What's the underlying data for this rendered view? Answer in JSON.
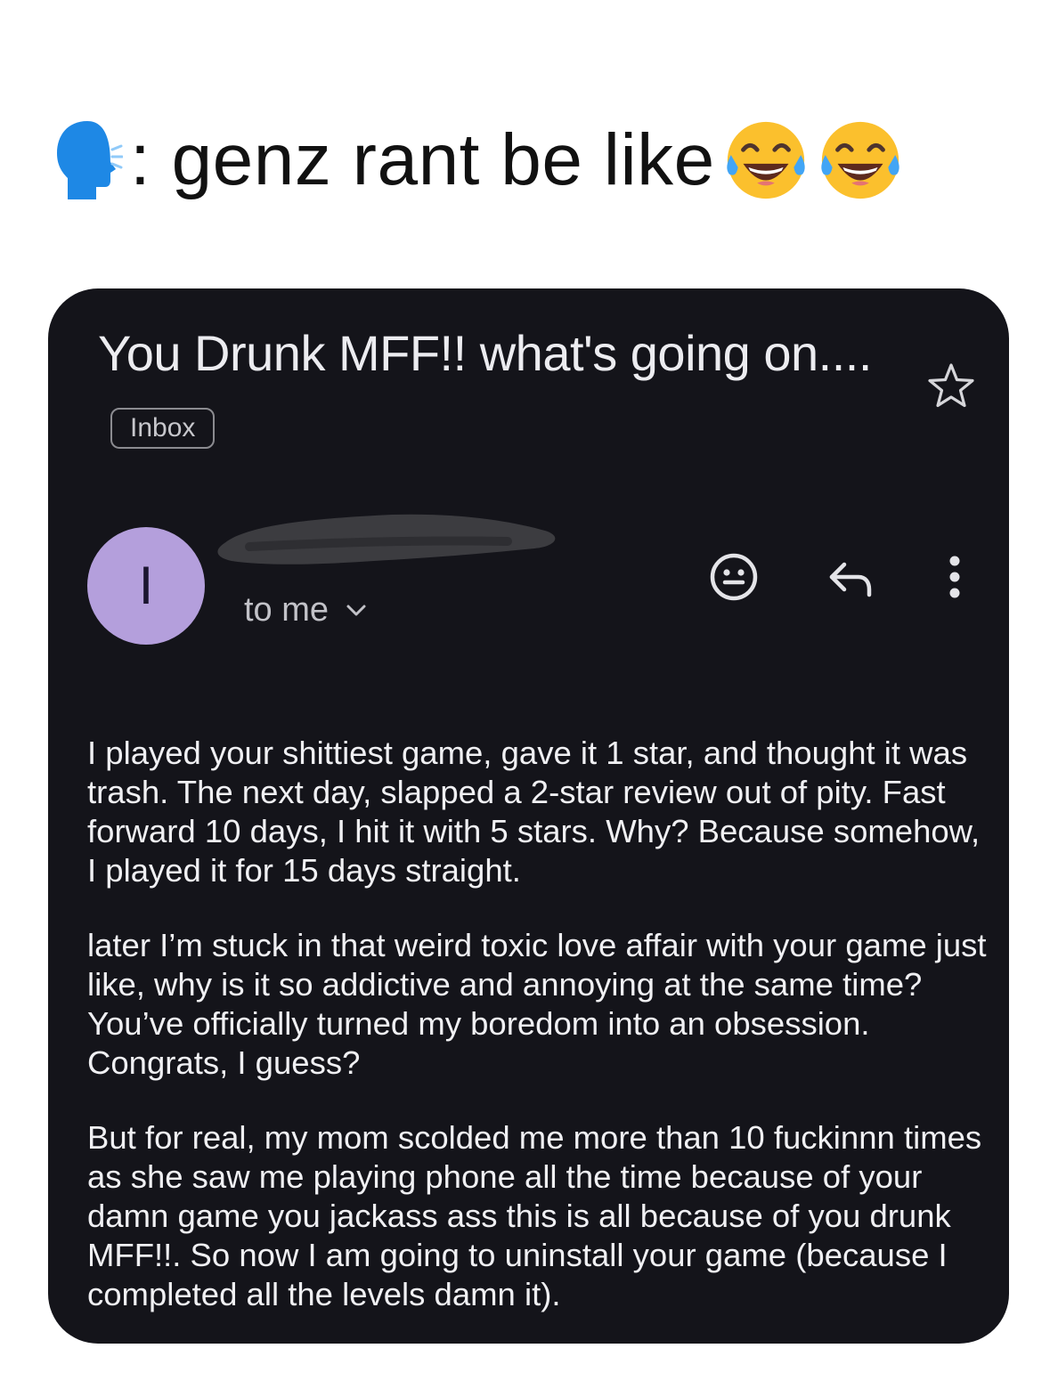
{
  "caption": {
    "text": ": genz rant be like",
    "icons": [
      "speaking-head-icon",
      "laughing-tears-icon",
      "laughing-tears-icon"
    ]
  },
  "email": {
    "subject": "You Drunk MFF!! what's going on....",
    "label": "Inbox",
    "sender_initial": "I",
    "sender_name_redacted": true,
    "recipient": "to me",
    "icons": [
      "star-icon",
      "emoji-reaction-icon",
      "reply-icon",
      "more-vert-icon",
      "chevron-down-icon"
    ],
    "paragraphs": [
      "I played your shittiest game, gave it 1 star, and thought it was trash. The next day, slapped a 2-star review out of pity. Fast forward 10 days, I hit it with 5 stars. Why? Because somehow, I played it for 15 days straight.",
      "later I’m stuck in that weird toxic love affair with your game just like, why is it so addictive and annoying at the same time? You’ve officially turned my boredom into an obsession. Congrats, I guess?",
      "But for real, my mom scolded me more than 10 fuckinnn times as she saw me playing phone all the time because of your damn game you jackass ass this is all because of you drunk MFF!!. So now I am going to uninstall your game (because I completed all the levels damn it)."
    ]
  },
  "colors": {
    "card_background": "#14141a",
    "avatar_background": "#b49fdc",
    "text_primary": "#f0f0f3",
    "text_secondary": "#c2c2c8"
  }
}
